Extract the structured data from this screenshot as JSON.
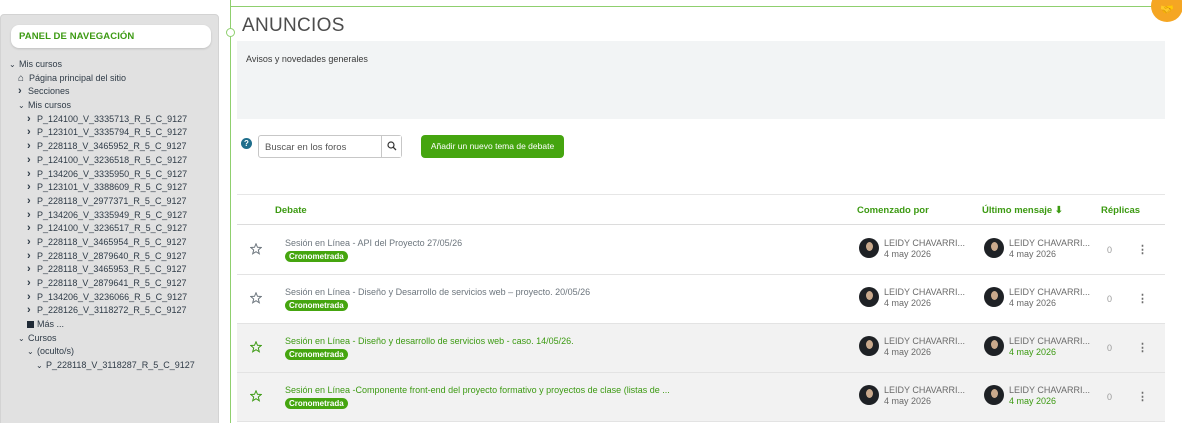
{
  "sidebar": {
    "header": "PANEL DE NAVEGACIÓN",
    "tree": [
      {
        "label": "Mis cursos",
        "icon": "chevron-down",
        "indent": 0
      },
      {
        "label": "Página principal del sitio",
        "icon": "home",
        "indent": 1
      },
      {
        "label": "Secciones",
        "icon": "chevron-right",
        "indent": 1
      },
      {
        "label": "Mis cursos",
        "icon": "chevron-down",
        "indent": 1
      },
      {
        "label": "P_124100_V_3335713_R_5_C_9127",
        "icon": "chevron-right",
        "indent": 2
      },
      {
        "label": "P_123101_V_3335794_R_5_C_9127",
        "icon": "chevron-right",
        "indent": 2
      },
      {
        "label": "P_228118_V_3465952_R_5_C_9127",
        "icon": "chevron-right",
        "indent": 2
      },
      {
        "label": "P_124100_V_3236518_R_5_C_9127",
        "icon": "chevron-right",
        "indent": 2
      },
      {
        "label": "P_134206_V_3335950_R_5_C_9127",
        "icon": "chevron-right",
        "indent": 2
      },
      {
        "label": "P_123101_V_3388609_R_5_C_9127",
        "icon": "chevron-right",
        "indent": 2
      },
      {
        "label": "P_228118_V_2977371_R_5_C_9127",
        "icon": "chevron-right",
        "indent": 2
      },
      {
        "label": "P_134206_V_3335949_R_5_C_9127",
        "icon": "chevron-right",
        "indent": 2
      },
      {
        "label": "P_124100_V_3236517_R_5_C_9127",
        "icon": "chevron-right",
        "indent": 2
      },
      {
        "label": "P_228118_V_3465954_R_5_C_9127",
        "icon": "chevron-right",
        "indent": 2
      },
      {
        "label": "P_228118_V_2879640_R_5_C_9127",
        "icon": "chevron-right",
        "indent": 2
      },
      {
        "label": "P_228118_V_3465953_R_5_C_9127",
        "icon": "chevron-right",
        "indent": 2
      },
      {
        "label": "P_228118_V_2879641_R_5_C_9127",
        "icon": "chevron-right",
        "indent": 2
      },
      {
        "label": "P_134206_V_3236066_R_5_C_9127",
        "icon": "chevron-right",
        "indent": 2
      },
      {
        "label": "P_228126_V_3118272_R_5_C_9127",
        "icon": "chevron-right",
        "indent": 2
      },
      {
        "label": "Más ...",
        "icon": "square",
        "indent": 2
      },
      {
        "label": "Cursos",
        "icon": "chevron-down",
        "indent": 1
      },
      {
        "label": "(oculto/s)",
        "icon": "chevron-down",
        "indent": 2
      },
      {
        "label": "P_228118_V_3118287_R_5_C_9127",
        "icon": "chevron-down",
        "indent": 3
      }
    ]
  },
  "main": {
    "title": "ANUNCIOS",
    "description": "Avisos y novedades generales",
    "search_placeholder": "Buscar en los foros",
    "add_button": "Añadir un nuevo tema de debate"
  },
  "table": {
    "headers": {
      "debate": "Debate",
      "started_by": "Comenzado por",
      "last_post": "Último mensaje",
      "replies": "Réplicas"
    },
    "rows": [
      {
        "topic": "Sesión en Línea - API del Proyecto 27/05/26",
        "badge": "Cronometrada",
        "started_by": "LEIDY CHAVARRI...",
        "started_date": "4 may 2026",
        "last_by": "LEIDY CHAVARRI...",
        "last_date": "4 may 2026",
        "replies": "0",
        "highlighted": false
      },
      {
        "topic": "Sesión en Línea - Diseño y Desarrollo de servicios web – proyecto. 20/05/26",
        "badge": "Cronometrada",
        "started_by": "LEIDY CHAVARRI...",
        "started_date": "4 may 2026",
        "last_by": "LEIDY CHAVARRI...",
        "last_date": "4 may 2026",
        "replies": "0",
        "highlighted": false
      },
      {
        "topic": "Sesión en Línea - Diseño y desarrollo de servicios web - caso. 14/05/26.",
        "badge": "Cronometrada",
        "started_by": "LEIDY CHAVARRI...",
        "started_date": "4 may 2026",
        "last_by": "LEIDY CHAVARRI...",
        "last_date": "4 may 2026",
        "replies": "0",
        "highlighted": true
      },
      {
        "topic": "Sesión en Línea -Componente front-end del proyecto formativo y proyectos de clase (listas de ...",
        "badge": "Cronometrada",
        "started_by": "LEIDY CHAVARRI...",
        "started_date": "4 may 2026",
        "last_by": "LEIDY CHAVARRI...",
        "last_date": "4 may 2026",
        "replies": "0",
        "highlighted": true
      }
    ]
  },
  "colors": {
    "accent": "#45a50f",
    "link_green": "#3c9a12",
    "sidebar_bg": "#e1e1e1"
  }
}
